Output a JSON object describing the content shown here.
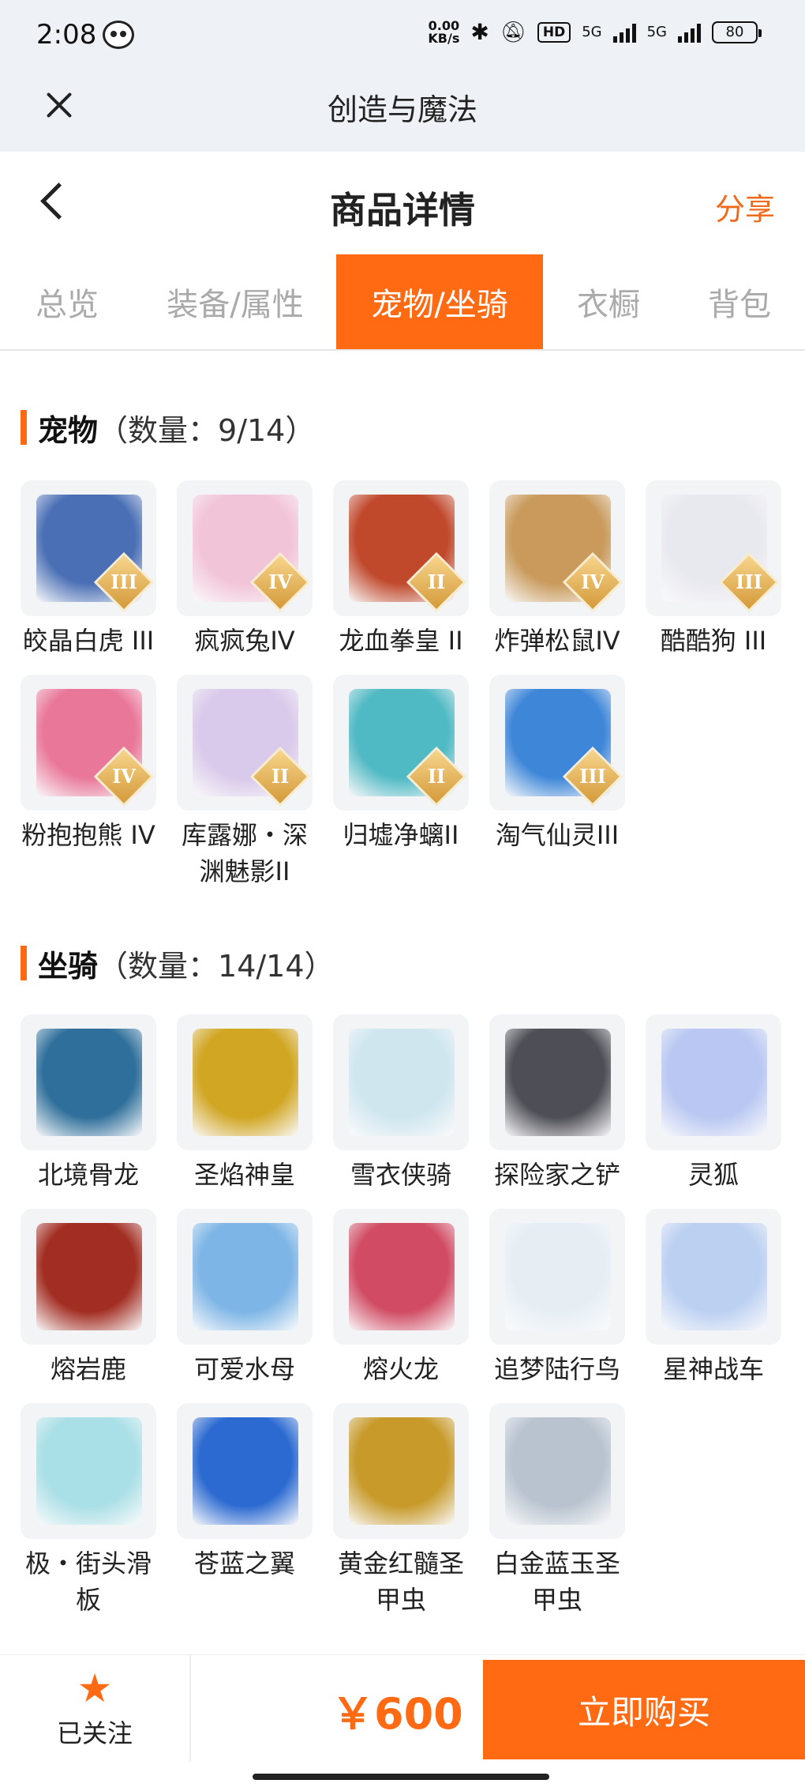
{
  "status_bar": {
    "time": "2:08",
    "net_speed_top": "0.00",
    "net_speed_bottom": "KB/s",
    "hd": "HD",
    "net1": "5G",
    "net2": "5G",
    "battery": "80"
  },
  "app_bar": {
    "title": "创造与魔法"
  },
  "header": {
    "title": "商品详情",
    "share_label": "分享"
  },
  "tabs": [
    {
      "label": "总览",
      "active": false
    },
    {
      "label": "装备/属性",
      "active": false
    },
    {
      "label": "宠物/坐骑",
      "active": true
    },
    {
      "label": "衣橱",
      "active": false
    },
    {
      "label": "背包",
      "active": false
    }
  ],
  "pets": {
    "title": "宠物",
    "count": "（数量：9/14）",
    "items": [
      {
        "name": "皎晶白虎 III",
        "badge": "III",
        "color": "#4a6fb5"
      },
      {
        "name": "疯疯兔IV",
        "badge": "IV",
        "color": "#f2c4d8"
      },
      {
        "name": "龙血拳皇 II",
        "badge": "II",
        "color": "#c0492c"
      },
      {
        "name": "炸弹松鼠IV",
        "badge": "IV",
        "color": "#c99a5b"
      },
      {
        "name": "酷酷狗 III",
        "badge": "III",
        "color": "#e8e8ef"
      },
      {
        "name": "粉抱抱熊 IV",
        "badge": "IV",
        "color": "#e9779a"
      },
      {
        "name": "库露娜・深渊魅影II",
        "badge": "II",
        "color": "#d9c9ea"
      },
      {
        "name": "归墟净螭II",
        "badge": "II",
        "color": "#4fb9c4"
      },
      {
        "name": "淘气仙灵III",
        "badge": "III",
        "color": "#3d86d8"
      }
    ]
  },
  "mounts": {
    "title": "坐骑",
    "count": "（数量：14/14）",
    "items": [
      {
        "name": "北境骨龙",
        "color": "#2f6f9b"
      },
      {
        "name": "圣焰神皇",
        "color": "#d1a623"
      },
      {
        "name": "雪衣侠骑",
        "color": "#cfe6ef"
      },
      {
        "name": "探险家之铲",
        "color": "#4e4e56"
      },
      {
        "name": "灵狐",
        "color": "#b9c7f2"
      },
      {
        "name": "熔岩鹿",
        "color": "#a22d22"
      },
      {
        "name": "可爱水母",
        "color": "#7db5e6"
      },
      {
        "name": "熔火龙",
        "color": "#d04b63"
      },
      {
        "name": "追梦陆行鸟",
        "color": "#e6eef4"
      },
      {
        "name": "星神战车",
        "color": "#bcd0f2"
      },
      {
        "name": "极・街头滑板",
        "color": "#a9dfe6"
      },
      {
        "name": "苍蓝之翼",
        "color": "#2c6ad1"
      },
      {
        "name": "黄金红髓圣甲虫",
        "color": "#c79a2a"
      },
      {
        "name": "白金蓝玉圣甲虫",
        "color": "#b9c3cf"
      }
    ]
  },
  "bottom": {
    "follow_label": "已关注",
    "price": "￥600",
    "buy_label": "立即购买"
  },
  "colors": {
    "accent": "#ff6a13",
    "share": "#ef6a1b"
  }
}
